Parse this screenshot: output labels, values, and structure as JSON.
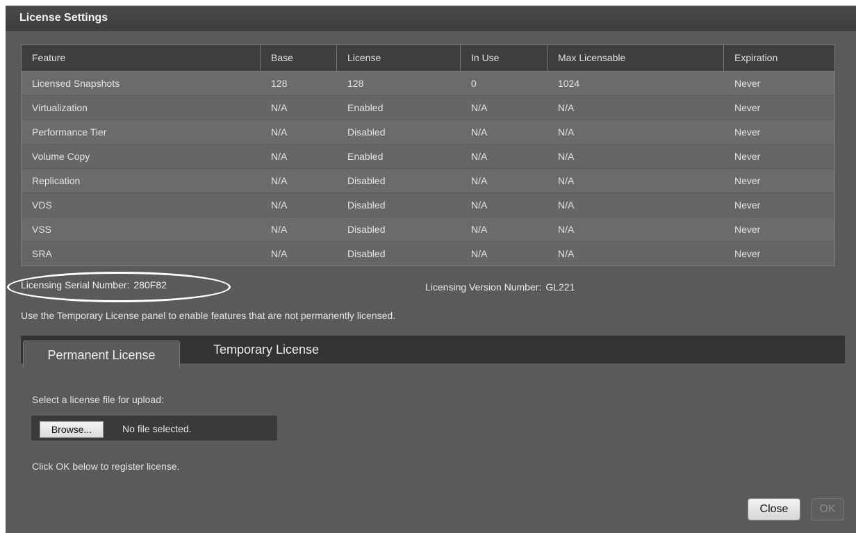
{
  "dialog": {
    "title": "License Settings"
  },
  "table": {
    "columns": [
      "Feature",
      "Base",
      "License",
      "In Use",
      "Max Licensable",
      "Expiration"
    ],
    "rows": [
      [
        "Licensed Snapshots",
        "128",
        "128",
        "0",
        "1024",
        "Never"
      ],
      [
        "Virtualization",
        "N/A",
        "Enabled",
        "N/A",
        "N/A",
        "Never"
      ],
      [
        "Performance Tier",
        "N/A",
        "Disabled",
        "N/A",
        "N/A",
        "Never"
      ],
      [
        "Volume Copy",
        "N/A",
        "Enabled",
        "N/A",
        "N/A",
        "Never"
      ],
      [
        "Replication",
        "N/A",
        "Disabled",
        "N/A",
        "N/A",
        "Never"
      ],
      [
        "VDS",
        "N/A",
        "Disabled",
        "N/A",
        "N/A",
        "Never"
      ],
      [
        "VSS",
        "N/A",
        "Disabled",
        "N/A",
        "N/A",
        "Never"
      ],
      [
        "SRA",
        "N/A",
        "Disabled",
        "N/A",
        "N/A",
        "Never"
      ]
    ]
  },
  "serial": {
    "label": "Licensing Serial Number:",
    "value": "280F82"
  },
  "version": {
    "label": "Licensing Version Number:",
    "value": "GL221"
  },
  "hint": "Use the Temporary License panel to enable features that are not permanently licensed.",
  "tabs": {
    "permanent": "Permanent License",
    "temporary": "Temporary License"
  },
  "upload": {
    "label": "Select a license file for upload:",
    "browse": "Browse...",
    "status": "No file selected.",
    "ok_hint": "Click OK below to register license."
  },
  "buttons": {
    "close": "Close",
    "ok": "OK"
  }
}
